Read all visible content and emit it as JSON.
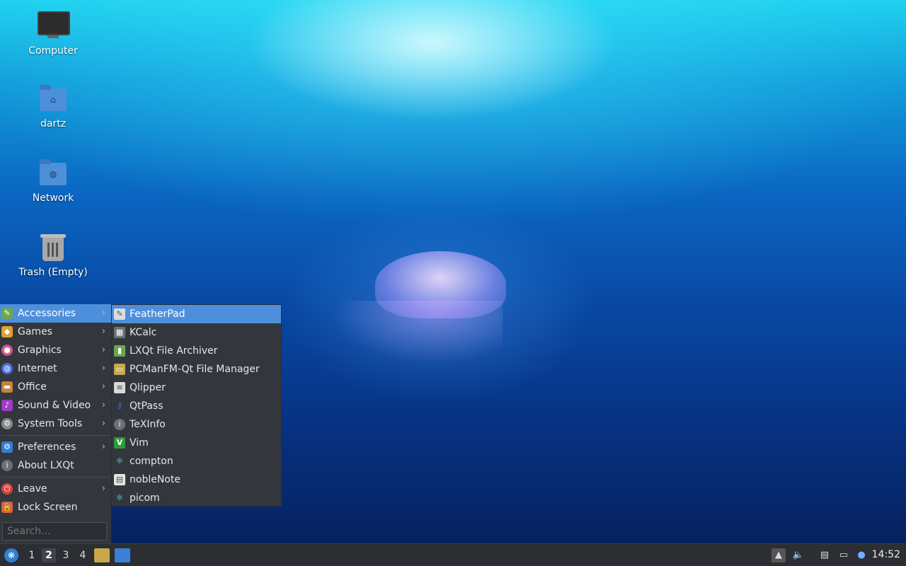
{
  "desktop": {
    "icons": [
      {
        "label": "Computer"
      },
      {
        "label": "dartz"
      },
      {
        "label": "Network"
      },
      {
        "label": "Trash (Empty)"
      }
    ]
  },
  "menu": {
    "categories": [
      {
        "label": "Accessories",
        "icon": "accessories-icon",
        "color": "#6aa84f"
      },
      {
        "label": "Games",
        "icon": "games-icon",
        "color": "#e0a030"
      },
      {
        "label": "Graphics",
        "icon": "graphics-icon",
        "color": "#d05a8a"
      },
      {
        "label": "Internet",
        "icon": "internet-icon",
        "color": "#4a6ee0"
      },
      {
        "label": "Office",
        "icon": "office-icon",
        "color": "#c8843a"
      },
      {
        "label": "Sound & Video",
        "icon": "sound-video-icon",
        "color": "#a03ac8"
      },
      {
        "label": "System Tools",
        "icon": "system-tools-icon",
        "color": "#888888"
      }
    ],
    "preferences": {
      "label": "Preferences"
    },
    "about": {
      "label": "About LXQt"
    },
    "leave": {
      "label": "Leave"
    },
    "lock": {
      "label": "Lock Screen"
    },
    "search_placeholder": "Search...",
    "arrow": "›"
  },
  "submenu": {
    "items": [
      {
        "label": "FeatherPad",
        "icon": "featherpad-icon",
        "color": "#5a5f66"
      },
      {
        "label": "KCalc",
        "icon": "kcalc-icon",
        "color": "#6c7176"
      },
      {
        "label": "LXQt File Archiver",
        "icon": "archiver-icon",
        "color": "#6aa84f"
      },
      {
        "label": "PCManFM-Qt File Manager",
        "icon": "file-manager-icon",
        "color": "#c9a74a"
      },
      {
        "label": "Qlipper",
        "icon": "clipboard-icon",
        "color": "#d9d9d9"
      },
      {
        "label": "QtPass",
        "icon": "qtpass-icon",
        "color": "#3b6fc9"
      },
      {
        "label": "TeXInfo",
        "icon": "info-icon",
        "color": "#6c7176"
      },
      {
        "label": "Vim",
        "icon": "vim-icon",
        "color": "#2e9a3e"
      },
      {
        "label": "compton",
        "icon": "compton-icon",
        "color": "#3fa8a0"
      },
      {
        "label": "nobleNote",
        "icon": "noblenote-icon",
        "color": "#e6e6e6"
      },
      {
        "label": "picom",
        "icon": "picom-icon",
        "color": "#3fa8a0"
      }
    ]
  },
  "taskbar": {
    "desktops": [
      "1",
      "2",
      "3",
      "4"
    ],
    "current_desktop": "2",
    "clock": "14:52"
  },
  "colors": {
    "accent": "#4e8fdc",
    "panel": "#2b2e33",
    "menu_bg": "#33373d"
  }
}
